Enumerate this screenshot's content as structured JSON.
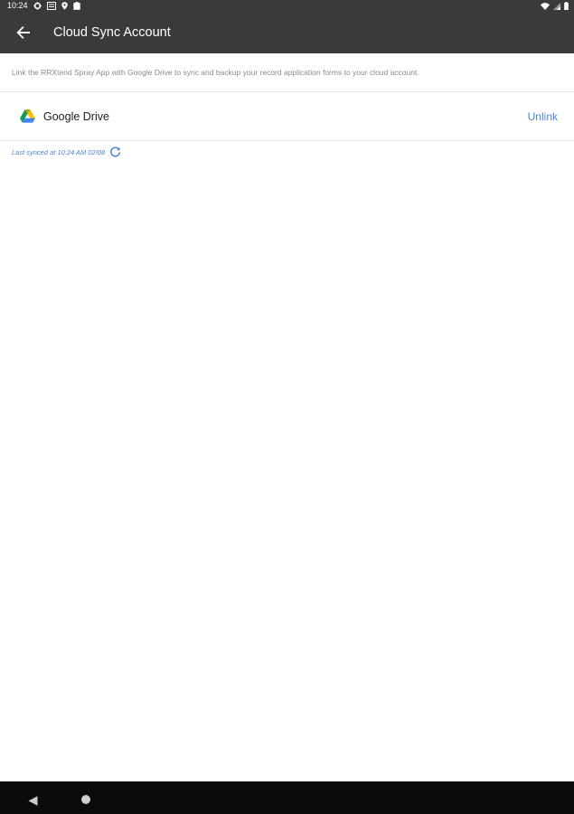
{
  "status_bar": {
    "time": "10:24",
    "left_icons": [
      "gear-icon",
      "document-icon",
      "location-icon",
      "clipboard-icon"
    ],
    "right_icons": [
      "wifi-icon",
      "signal-icon",
      "battery-icon"
    ]
  },
  "app_bar": {
    "title": "Cloud Sync Account",
    "back_icon": "arrow-left-icon"
  },
  "description": "Link the RRXtend Spray App with Google Drive to sync and backup your record application forms to your cloud account.",
  "account": {
    "provider_icon": "google-drive-icon",
    "provider_name": "Google Drive",
    "action_label": "Unlink"
  },
  "sync": {
    "text": "Last synced at 10:24 AM 02/08",
    "refresh_icon": "refresh-icon"
  },
  "nav_bar": {
    "icons": [
      "back-triangle-icon",
      "home-circle-icon"
    ]
  },
  "colors": {
    "app_bar": "#3a3a3a",
    "accent": "#4f82d9",
    "description_text": "#8a8a8a",
    "nav_bar": "#0b0b0b"
  }
}
